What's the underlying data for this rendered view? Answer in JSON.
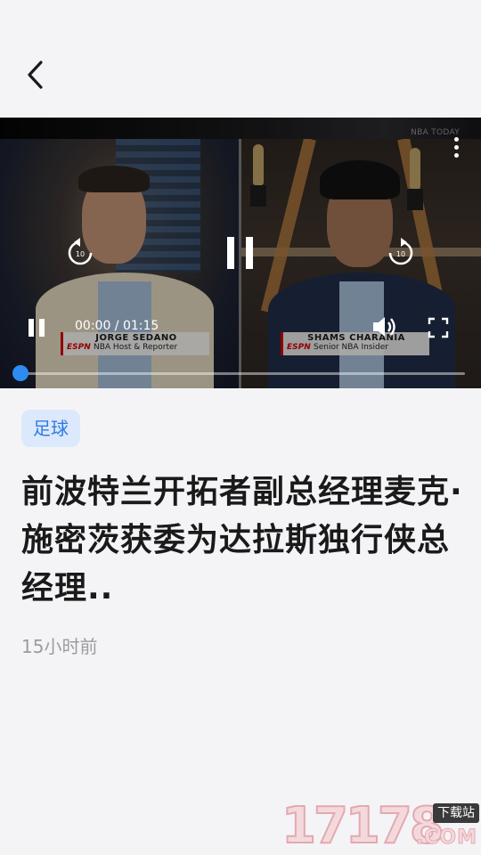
{
  "header": {
    "back_icon": "chevron-left-icon"
  },
  "video": {
    "network_bug": "NBA TODAY",
    "time_display": "00:00 / 01:15",
    "progress": 0,
    "accent_color": "#2d8cf0",
    "left_caption": {
      "brand": "ESPN",
      "name": "JORGE SEDANO",
      "role": "NBA Host & Reporter"
    },
    "right_caption": {
      "brand": "ESPN",
      "name": "SHAMS CHARANIA",
      "role": "Senior NBA Insider"
    },
    "controls": {
      "rewind_label": "10",
      "forward_label": "10"
    }
  },
  "article": {
    "tag": "足球",
    "title": "前波特兰开拓者副总经理麦克·施密茨获委为达拉斯独行侠总经理..",
    "time_ago": "15小时前"
  },
  "watermark": {
    "digits": "17178",
    "badge": "下载站",
    "suffix": ".COM"
  }
}
